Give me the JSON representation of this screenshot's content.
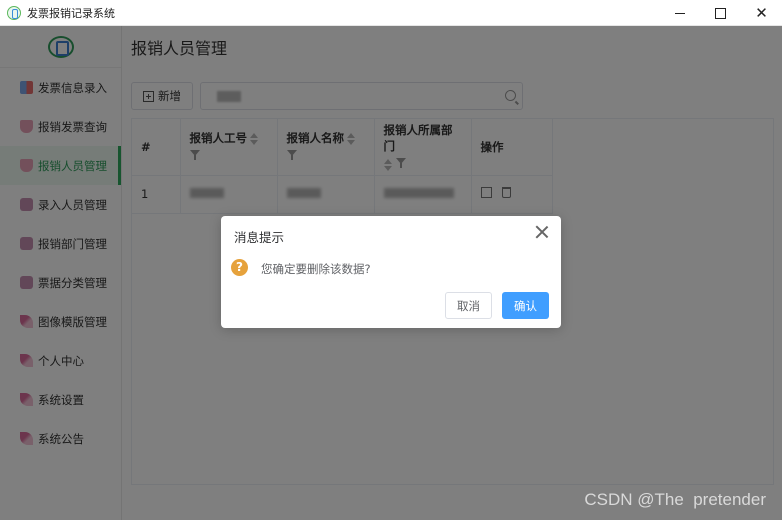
{
  "window": {
    "title": "发票报销记录系统",
    "controls": [
      "minimize",
      "maximize",
      "close"
    ]
  },
  "sidebar": {
    "logo_icon": "logo-icon",
    "items": [
      {
        "label": "发票信息录入",
        "icon": "grid-icon",
        "active": false
      },
      {
        "label": "报销发票查询",
        "icon": "bag-icon",
        "active": false
      },
      {
        "label": "报销人员管理",
        "icon": "bag-icon",
        "active": true
      },
      {
        "label": "录入人员管理",
        "icon": "camera-icon",
        "active": false
      },
      {
        "label": "报销部门管理",
        "icon": "camera-icon",
        "active": false
      },
      {
        "label": "票据分类管理",
        "icon": "camera-icon",
        "active": false
      },
      {
        "label": "图像模版管理",
        "icon": "feather-icon",
        "active": false
      },
      {
        "label": "个人中心",
        "icon": "feather-icon",
        "active": false
      },
      {
        "label": "系统设置",
        "icon": "feather-icon",
        "active": false
      },
      {
        "label": "系统公告",
        "icon": "feather-icon",
        "active": false
      }
    ]
  },
  "main": {
    "page_title": "报销人员管理",
    "add_button": "新增",
    "search_value": "",
    "table": {
      "headers": [
        "#",
        "报销人工号",
        "报销人名称",
        "报销人所属部门",
        "操作"
      ],
      "rows": [
        {
          "index": "1"
        }
      ]
    }
  },
  "dialog": {
    "title": "消息提示",
    "message": "您确定要删除该数据?",
    "cancel": "取消",
    "confirm": "确认",
    "icon": "warning-icon",
    "icon_glyph": "?"
  },
  "watermark": "CSDN @The  pretender",
  "colors": {
    "accent": "#2eaa5e",
    "primary_button": "#409eff",
    "warning": "#e6a23c"
  }
}
